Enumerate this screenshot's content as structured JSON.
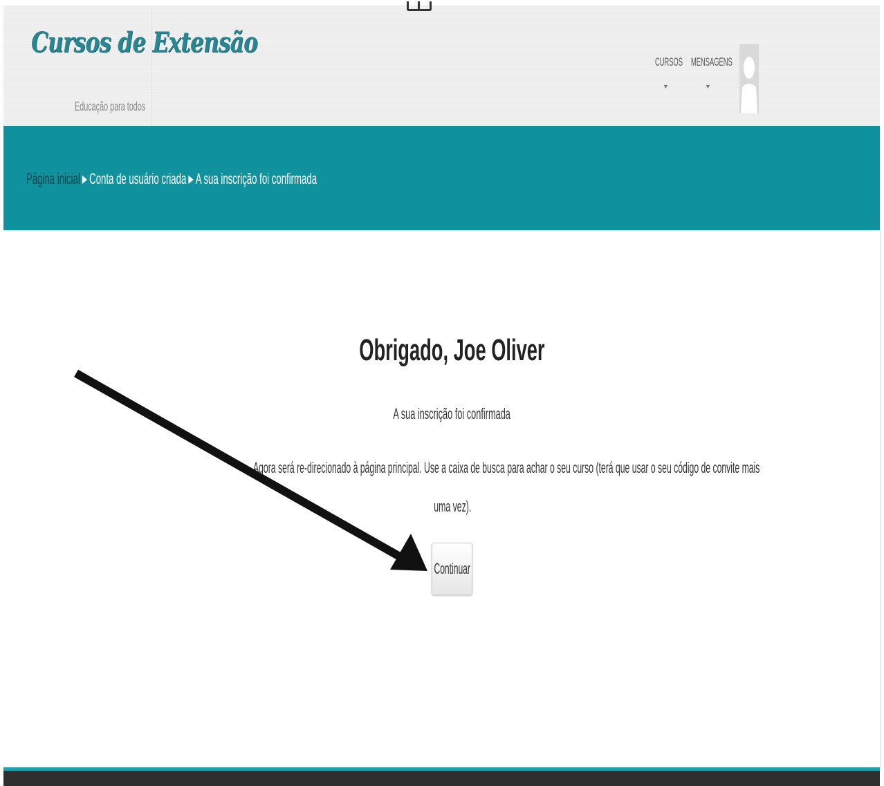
{
  "header": {
    "site_title": "Cursos de Extensão",
    "slogan": "Educação para todos",
    "nav": [
      {
        "label": "CURSOS",
        "caret": "▼"
      },
      {
        "label": "MENSAGENS",
        "caret": "▼"
      }
    ],
    "avatar_icon": "user-silhouette-icon"
  },
  "breadcrumb": {
    "items": [
      "Página inicial",
      "Conta de usuário criada",
      "A sua inscrição foi confirmada"
    ],
    "separator": "▶"
  },
  "main": {
    "title": "Obrigado, Joe Oliver",
    "subtitle": "A sua inscrição foi confirmada",
    "message_line1": "Agora será re-direcionado à página principal. Use a caixa de busca para achar o seu curso (terá que usar o seu código de convite mais",
    "message_line2": "uma vez).",
    "continue_label": "Continuar"
  },
  "annotation": {
    "arrow_icon": "pointer-arrow-icon",
    "arrow_color": "#111111"
  },
  "colors": {
    "band": "#0f929e",
    "logo": "#2a8591",
    "footer": "#2f2f2f",
    "footer_accent": "#1aa1ad"
  }
}
